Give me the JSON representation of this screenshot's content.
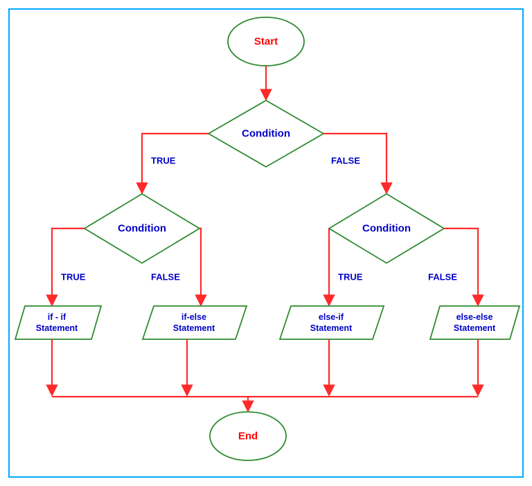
{
  "flowchart": {
    "start": "Start",
    "end": "End",
    "cond_top": "Condition",
    "cond_left": "Condition",
    "cond_right": "Condition",
    "true_label": "TRUE",
    "false_label": "FALSE",
    "stmt_if_if_l1": "if - if",
    "stmt_if_if_l2": "Statement",
    "stmt_if_else_l1": "if-else",
    "stmt_if_else_l2": "Statement",
    "stmt_else_if_l1": "else-if",
    "stmt_else_if_l2": "Statement",
    "stmt_else_else_l1": "else-else",
    "stmt_else_else_l2": "Statement"
  }
}
